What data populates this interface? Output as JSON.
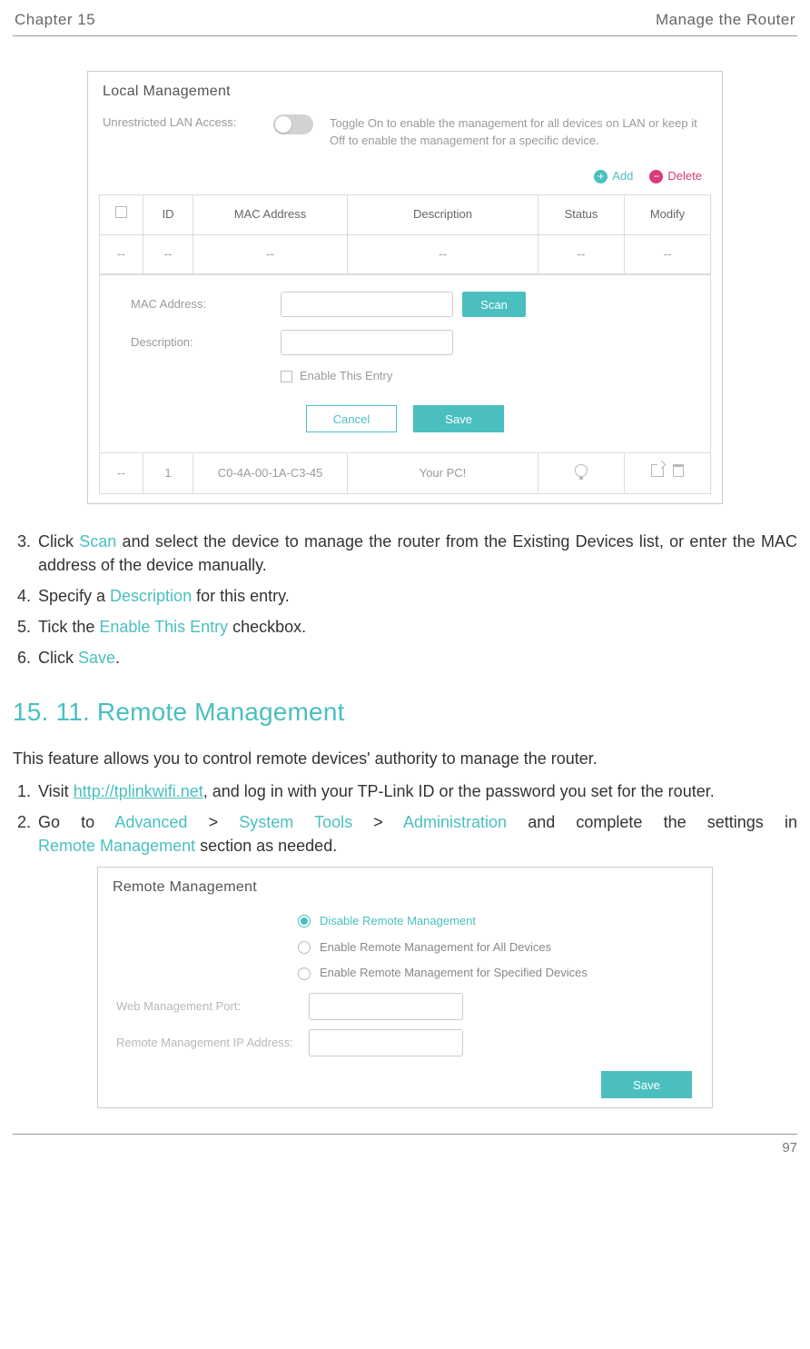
{
  "page": {
    "chapter": "Chapter 15",
    "title": "Manage the Router",
    "number": "97"
  },
  "local_mgmt": {
    "panel_title": "Local Management",
    "toggle_label": "Unrestricted LAN Access:",
    "toggle_help": "Toggle On to enable the management for all devices on LAN or keep it Off to enable the management for a specific device.",
    "toolbar": {
      "add": "Add",
      "delete": "Delete"
    },
    "columns": {
      "id": "ID",
      "mac": "MAC Address",
      "desc": "Description",
      "status": "Status",
      "modify": "Modify"
    },
    "blank": "--",
    "edit": {
      "mac_label": "MAC Address:",
      "desc_label": "Description:",
      "enable_label": "Enable This Entry",
      "scan": "Scan",
      "cancel": "Cancel",
      "save": "Save"
    },
    "row2": {
      "id": "1",
      "mac": "C0-4A-00-1A-C3-45",
      "desc": "Your PC!"
    }
  },
  "steps_a": [
    {
      "n": "3.",
      "pre": "Click ",
      "kw": "Scan",
      "post": " and select the device to manage the router from the Existing Devices list, or enter the MAC address of the device manually."
    },
    {
      "n": "4.",
      "pre": "Specify a ",
      "kw": "Description",
      "post": " for this entry."
    },
    {
      "n": "5.",
      "pre": "Tick the ",
      "kw": "Enable This Entry",
      "post": " checkbox."
    },
    {
      "n": "6.",
      "pre": "Click ",
      "kw": "Save",
      "post": "."
    }
  ],
  "section": {
    "heading": "15. 11. Remote Management",
    "intro": "This feature allows you to control remote devices' authority to manage the router."
  },
  "steps_b": {
    "s1": {
      "n": "1.",
      "pre": "Visit ",
      "link": "http://tplinkwifi.net",
      "post": ", and log in with your TP-Link ID or the password you set for the router."
    },
    "s2": {
      "n": "2.",
      "t_goto": "Go to ",
      "a": "Advanced",
      "gt1": " > ",
      "b": "System Tools",
      "gt2": " > ",
      "c": "Administration",
      "mid": " and complete the settings in ",
      "d": "Remote Management",
      "post": " section as needed."
    }
  },
  "remote_mgmt": {
    "panel_title": "Remote Management",
    "options": [
      "Disable Remote Management",
      "Enable Remote Management for All Devices",
      "Enable Remote Management for Specified Devices"
    ],
    "port_label": "Web Management Port:",
    "ip_label": "Remote Management IP Address:",
    "save": "Save"
  }
}
